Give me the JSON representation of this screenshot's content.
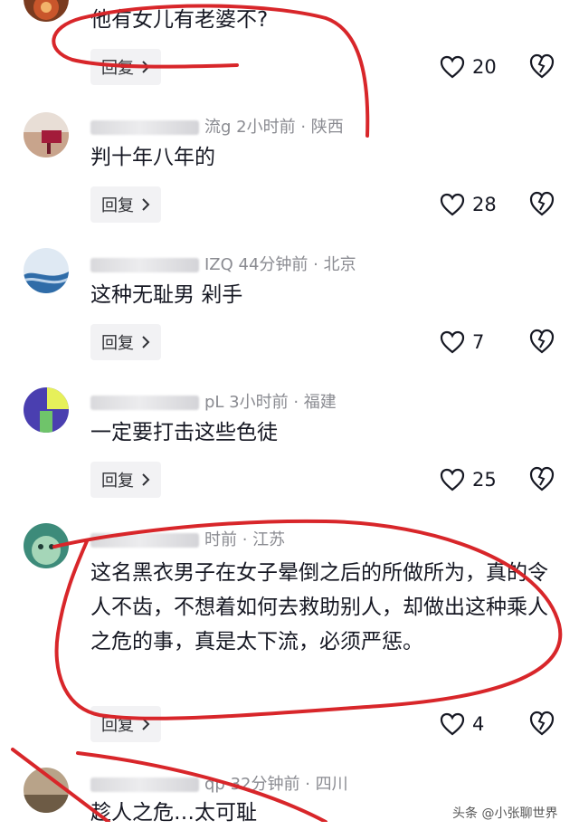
{
  "comments": [
    {
      "meta": "",
      "text": "他有女儿有老婆不?",
      "reply": "回复",
      "likes": "20",
      "avatar_colors": [
        "#7a3b1f",
        "#c9562b"
      ]
    },
    {
      "meta": "流g  2小时前 · 陕西",
      "text": "判十年八年的",
      "reply": "回复",
      "likes": "28",
      "avatar_colors": [
        "#c8a48c",
        "#a31c3a"
      ]
    },
    {
      "meta": "IZQ  44分钟前 · 北京",
      "text": "这种无耻男 剁手",
      "reply": "回复",
      "likes": "7",
      "avatar_colors": [
        "#bcd3ea",
        "#2f6ca8"
      ]
    },
    {
      "meta": "pL  3小时前 · 福建",
      "text": "一定要打击这些色徒",
      "reply": "回复",
      "likes": "25",
      "avatar_colors": [
        "#4a3fb0",
        "#e6f05a"
      ]
    },
    {
      "meta": "时前 · 江苏",
      "text": "这名黑衣男子在女子晕倒之后的所做所为，真的令人不齿，不想着如何去救助别人，却做出这种乘人之危的事，真是太下流，必须严惩。",
      "reply": "回复",
      "likes": "4",
      "avatar_colors": [
        "#3d8b7a",
        "#a5d6b8"
      ]
    },
    {
      "meta": "qp  32分钟前 · 四川",
      "text": "趁人之危…太可耻",
      "reply": "",
      "likes": "",
      "avatar_colors": [
        "#b8a389",
        "#6d5b45"
      ]
    }
  ],
  "watermark": "头条 @小张聊世界",
  "colors": {
    "annotation": "#d8262a",
    "reply_bg": "#f2f2f4",
    "meta_text": "#8a8b91"
  },
  "icons": {
    "like": "heart-icon",
    "dislike": "broken-heart-icon",
    "chevron": "chevron-right-icon"
  }
}
